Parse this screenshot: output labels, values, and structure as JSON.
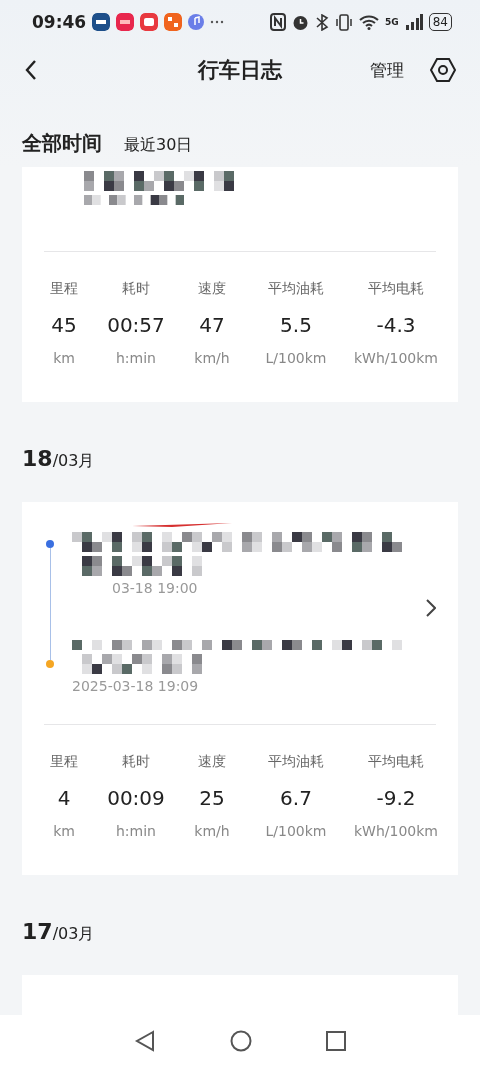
{
  "status_bar": {
    "time": "09:46",
    "battery": "84",
    "network": "5G"
  },
  "header": {
    "title": "行车日志",
    "action": "管理"
  },
  "filter": {
    "primary": "全部时间",
    "secondary": "最近30日"
  },
  "top_card": {
    "stats": [
      {
        "label": "里程",
        "value": "45",
        "unit": "km"
      },
      {
        "label": "耗时",
        "value": "00:57",
        "unit": "h:min"
      },
      {
        "label": "速度",
        "value": "47",
        "unit": "km/h"
      },
      {
        "label": "平均油耗",
        "value": "5.5",
        "unit": "L/100km"
      },
      {
        "label": "平均电耗",
        "value": "-4.3",
        "unit": "kWh/100km"
      }
    ]
  },
  "sections": [
    {
      "day": "18",
      "month": "/03月",
      "trip": {
        "start_time": "03-18 19:00",
        "end_time": "2025-03-18 19:09",
        "stats": [
          {
            "label": "里程",
            "value": "4",
            "unit": "km"
          },
          {
            "label": "耗时",
            "value": "00:09",
            "unit": "h:min"
          },
          {
            "label": "速度",
            "value": "25",
            "unit": "km/h"
          },
          {
            "label": "平均油耗",
            "value": "6.7",
            "unit": "L/100km"
          },
          {
            "label": "平均电耗",
            "value": "-9.2",
            "unit": "kWh/100km"
          }
        ]
      }
    },
    {
      "day": "17",
      "month": "/03月"
    }
  ]
}
